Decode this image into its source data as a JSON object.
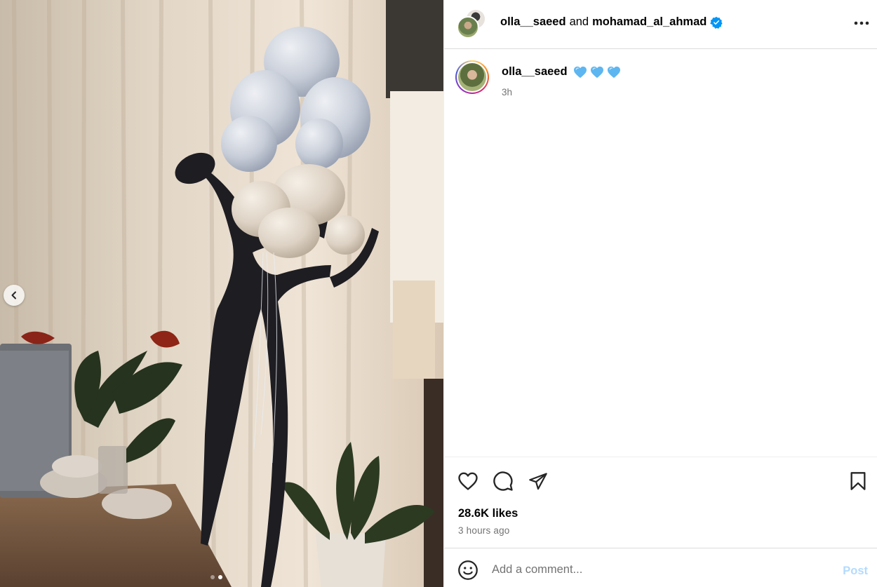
{
  "post": {
    "collab_user_1": "olla__saeed",
    "collab_joiner": "and",
    "collab_user_2": "mohamad_al_ahmad",
    "caption_user": "olla__saeed",
    "caption_time": "3h",
    "likes": "28.6K likes",
    "posted_ago": "3 hours ago"
  },
  "comment": {
    "placeholder": "Add a comment...",
    "post_label": "Post"
  },
  "carousel": {
    "slide_count": 2,
    "active_slide": 2
  },
  "colors": {
    "verified_blue": "#0095f6",
    "post_button_disabled": "#b3dbff",
    "heart_emoji_blue": "#5db6f0",
    "muted_text": "#737373",
    "divider": "#dbdbdb"
  },
  "icons": {
    "prev": "chevron-left-icon",
    "more": "more-options-icon",
    "verified": "verified-badge-icon",
    "like": "heart-icon",
    "comment": "comment-icon",
    "share": "share-icon",
    "save": "bookmark-icon",
    "emoji": "emoji-icon",
    "caption_emoji": "blue-heart-emoji"
  }
}
